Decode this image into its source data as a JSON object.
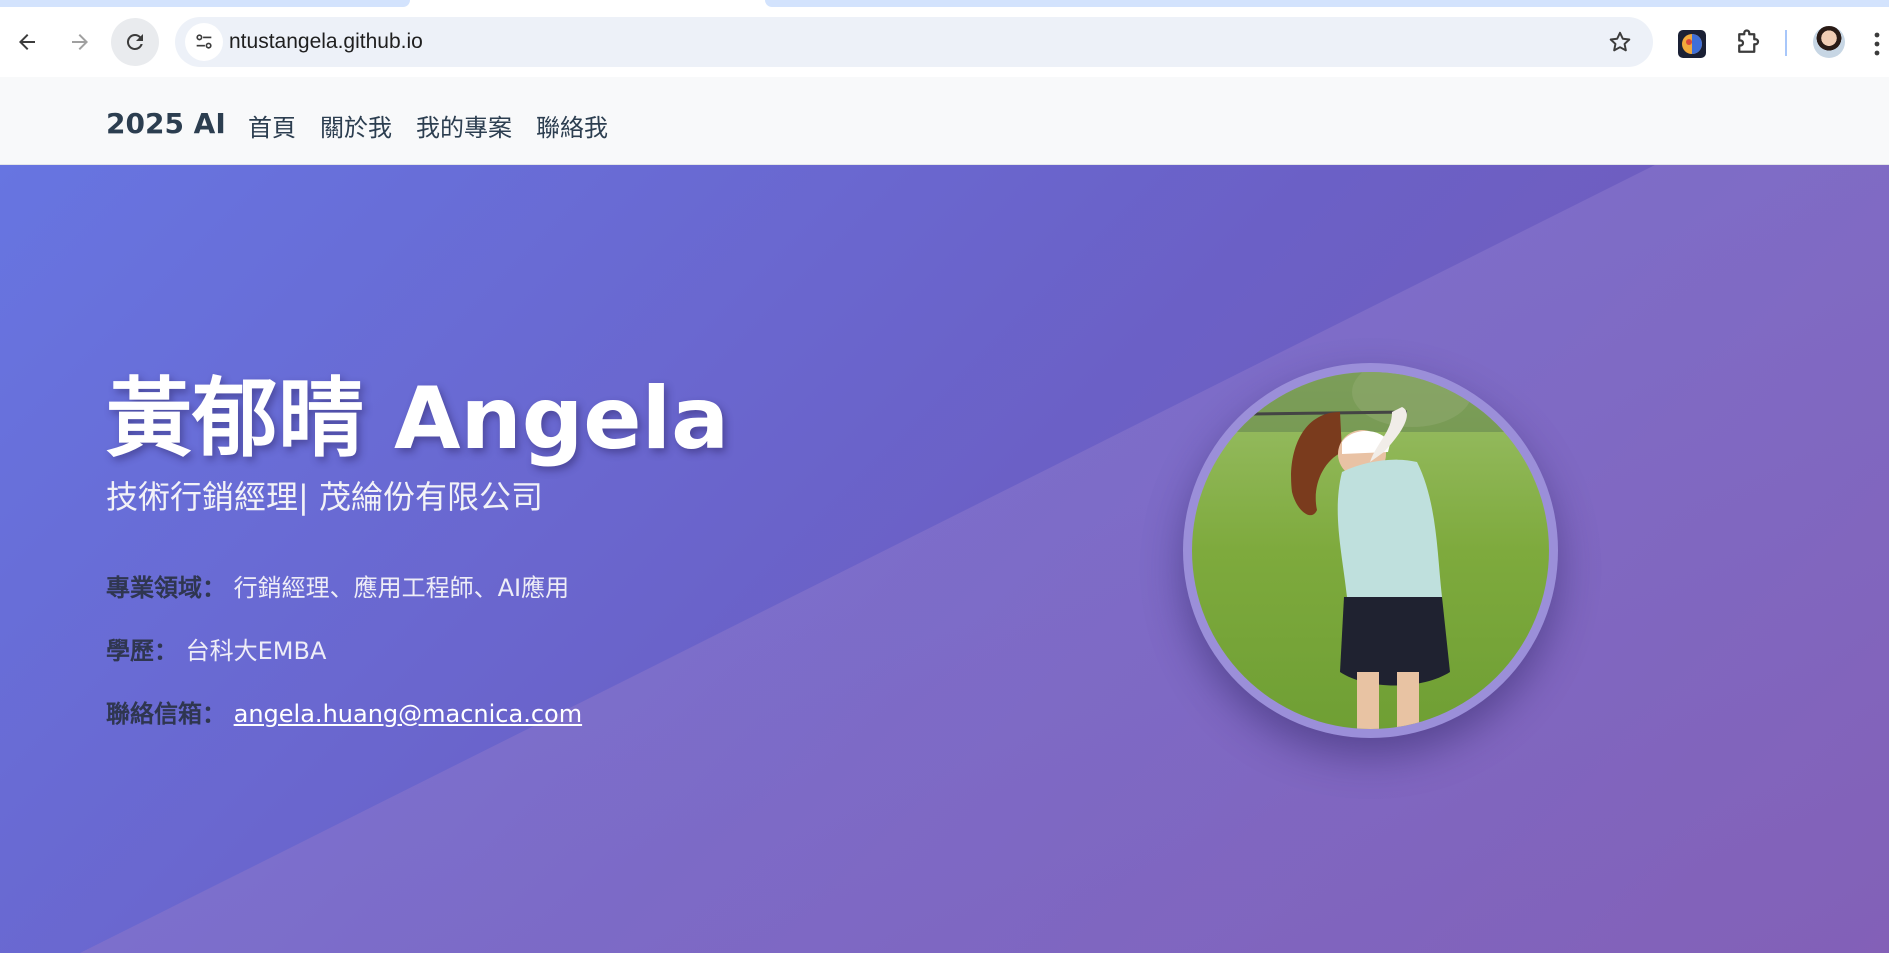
{
  "browser": {
    "url": "ntustangela.github.io",
    "icons": [
      "back-arrow-icon",
      "forward-arrow-icon",
      "reload-icon",
      "site-info-icon",
      "bookmark-star-icon",
      "extension-logo-icon",
      "extensions-puzzle-icon",
      "profile-avatar",
      "more-menu-icon"
    ]
  },
  "nav": {
    "brand": "2025 AI",
    "links": [
      "首頁",
      "關於我",
      "我的專案",
      "聯絡我"
    ]
  },
  "hero": {
    "name": "黃郁晴 Angela",
    "title": "技術行銷經理| 茂綸份有限公司",
    "rows": [
      {
        "label": "專業領域：",
        "value": "行銷經理、應用工程師、AI應用"
      },
      {
        "label": "學歷：",
        "value": "台科大EMBA"
      },
      {
        "label": "聯絡信箱：",
        "value": "angela.huang@macnica.com"
      }
    ]
  },
  "colors": {
    "hero_gradient_start": "#6775e1",
    "hero_gradient_end": "#7a59b0",
    "nav_background": "#f8f9fa",
    "nav_text": "#2c3e50"
  }
}
